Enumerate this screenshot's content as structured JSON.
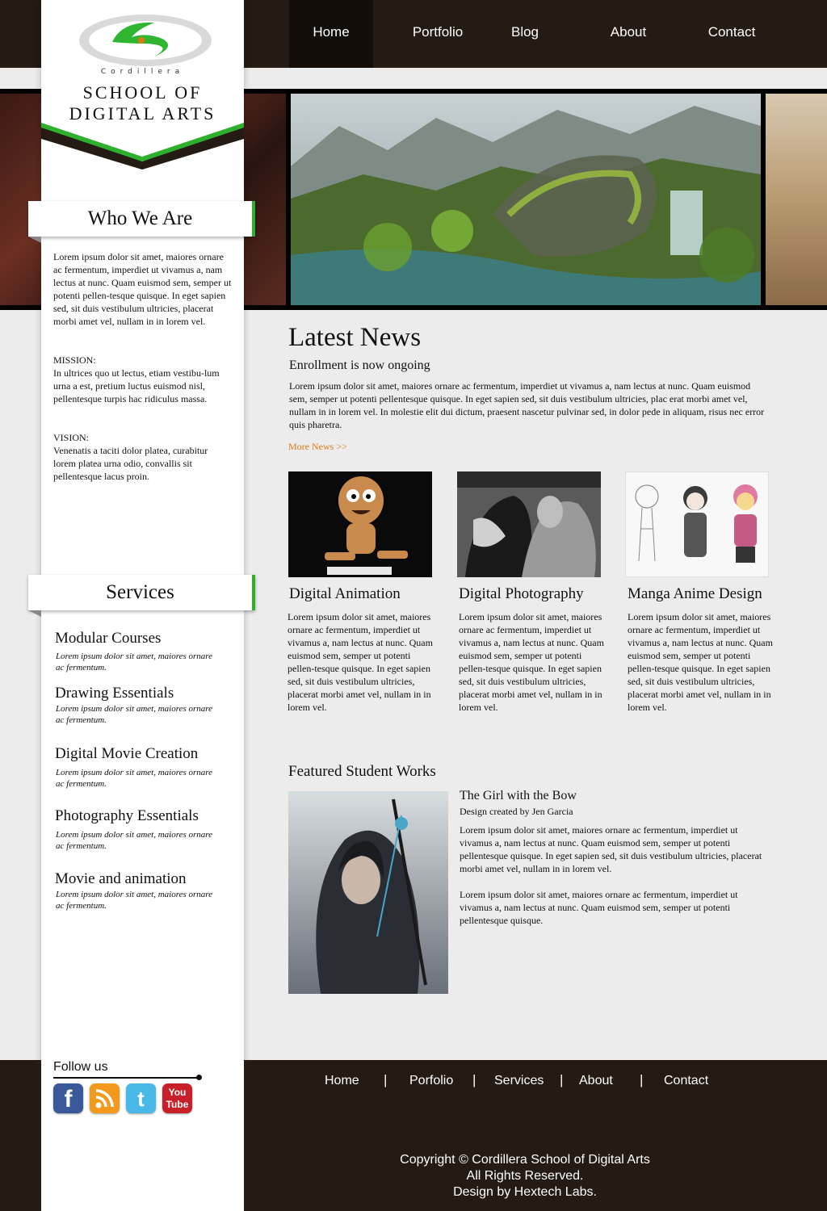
{
  "nav": {
    "items": [
      {
        "label": "Home",
        "active": true
      },
      {
        "label": "Portfolio"
      },
      {
        "label": "Blog"
      },
      {
        "label": "About"
      },
      {
        "label": "Contact"
      }
    ]
  },
  "logo": {
    "small": "Cordillera",
    "line1": "School of",
    "line2": "Digital Arts"
  },
  "who": {
    "title": "Who We Are",
    "intro": "Lorem ipsum dolor sit amet, maiores ornare ac fermentum, imperdiet ut vivamus a, nam lectus at nunc. Quam euismod sem, semper ut potenti pellen-tesque quisque. In eget sapien sed, sit duis vestibulum ultricies, placerat morbi amet vel, nullam in in lorem vel.",
    "mission_label": "MISSION:",
    "mission": "In ultrices quo ut lectus, etiam vestibu-lum urna a est, pretium luctus euismod nisl, pellentesque turpis hac ridiculus massa.",
    "vision_label": "VISION:",
    "vision": "Venenatis a taciti dolor platea, curabitur lorem platea urna odio, convallis sit pellentesque lacus proin."
  },
  "services": {
    "title": "Services",
    "items": [
      {
        "title": "Modular Courses",
        "desc": "Lorem ipsum dolor sit amet, maiores ornare ac fermentum."
      },
      {
        "title": "Drawing Essentials",
        "desc": "Lorem ipsum dolor sit amet, maiores ornare ac fermentum."
      },
      {
        "title": "Digital Movie Creation",
        "desc": "Lorem ipsum dolor sit amet, maiores ornare ac fermentum."
      },
      {
        "title": "Photography Essentials",
        "desc": "Lorem ipsum dolor sit amet, maiores ornare ac fermentum."
      },
      {
        "title": "Movie and animation",
        "desc": "Lorem ipsum dolor sit amet, maiores ornare ac fermentum."
      }
    ]
  },
  "news": {
    "title": "Latest News",
    "subtitle": "Enrollment is now ongoing",
    "body": "Lorem ipsum dolor sit amet, maiores ornare ac fermentum, imperdiet ut vivamus a, nam lectus at nunc. Quam euismod sem, semper ut potenti pellentesque quisque. In eget sapien sed, sit duis vestibulum ultricies, plac erat morbi amet vel, nullam in in lorem vel. In molestie elit dui dictum, praesent nascetur pulvinar sed, in dolor pede in aliquam, risus nec error quis pharetra.",
    "more": "More News >>"
  },
  "columns": [
    {
      "title": "Digital Animation",
      "body": "Lorem ipsum dolor sit amet, maiores ornare ac fermentum, imperdiet ut vivamus a, nam lectus at nunc. Quam euismod sem, semper ut potenti pellen-tesque quisque. In eget sapien sed, sit duis vestibulum ultricies, placerat morbi amet vel, nullam in in lorem vel."
    },
    {
      "title": "Digital Photography",
      "body": "Lorem ipsum dolor sit amet, maiores ornare ac fermentum, imperdiet ut vivamus a, nam lectus at nunc. Quam euismod sem, semper ut potenti pellen-tesque quisque. In eget sapien sed, sit duis vestibulum ultricies, placerat morbi amet vel, nullam in in lorem vel."
    },
    {
      "title": "Manga Anime Design",
      "body": "Lorem ipsum dolor sit amet, maiores ornare ac fermentum, imperdiet ut vivamus a, nam lectus at nunc. Quam euismod sem, semper ut potenti pellen-tesque quisque. In eget sapien sed, sit duis vestibulum ultricies, placerat morbi amet vel, nullam in in lorem vel."
    }
  ],
  "featured": {
    "heading": "Featured Student Works",
    "title": "The Girl with the Bow",
    "credit": "Design created by Jen Garcia",
    "p1": "Lorem ipsum dolor sit amet, maiores ornare ac fermentum, imperdiet ut vivamus a, nam lectus at nunc. Quam euismod sem, semper ut potenti pellentesque quisque. In eget sapien sed, sit duis vestibulum ultricies, placerat morbi amet vel, nullam in in lorem vel.",
    "p2": "Lorem ipsum dolor sit amet, maiores ornare ac fermentum, imperdiet ut vivamus a, nam lectus at nunc. Quam euismod sem, semper ut potenti pellentesque quisque."
  },
  "follow": {
    "label": "Follow us",
    "icons": [
      "facebook-icon",
      "rss-icon",
      "twitter-icon",
      "youtube-icon"
    ]
  },
  "footer": {
    "nav": [
      "Home",
      "Porfolio",
      "Services",
      "About",
      "Contact"
    ],
    "separator": "|",
    "copyright": "Copyright © Cordillera School of Digital Arts",
    "rights": "All Rights Reserved.",
    "design": "Design by Hextech Labs."
  },
  "colors": {
    "accent": "#2db02d",
    "link": "#e07a10",
    "dark": "#231b14"
  }
}
